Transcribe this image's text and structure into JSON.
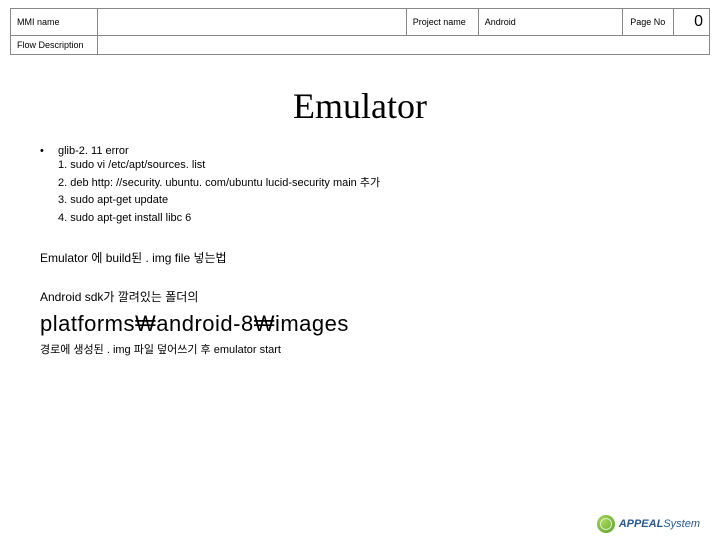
{
  "header": {
    "mmi_label": "MMI name",
    "mmi_value": "",
    "project_label": "Project name",
    "project_value": "Android",
    "page_label": "Page No",
    "page_value": "0",
    "flow_label": "Flow Description",
    "flow_value": ""
  },
  "title": "Emulator",
  "bullet_heading": "glib-2. 11 error",
  "steps": [
    "1. sudo vi /etc/apt/sources. list",
    "2. deb http: //security. ubuntu. com/ubuntu lucid-security main 추가",
    "3. sudo apt-get update",
    "4. sudo apt-get install libc 6"
  ],
  "sub1": "Emulator 에 build된 . img file 넣는법",
  "sub2": "Android sdk가 깔려있는 폴더의",
  "path": "platforms₩android-8₩images",
  "final": "경로에 생성된 . img 파일 덮어쓰기 후 emulator start",
  "logo": {
    "bold": "APPEAL",
    "light": "System"
  }
}
